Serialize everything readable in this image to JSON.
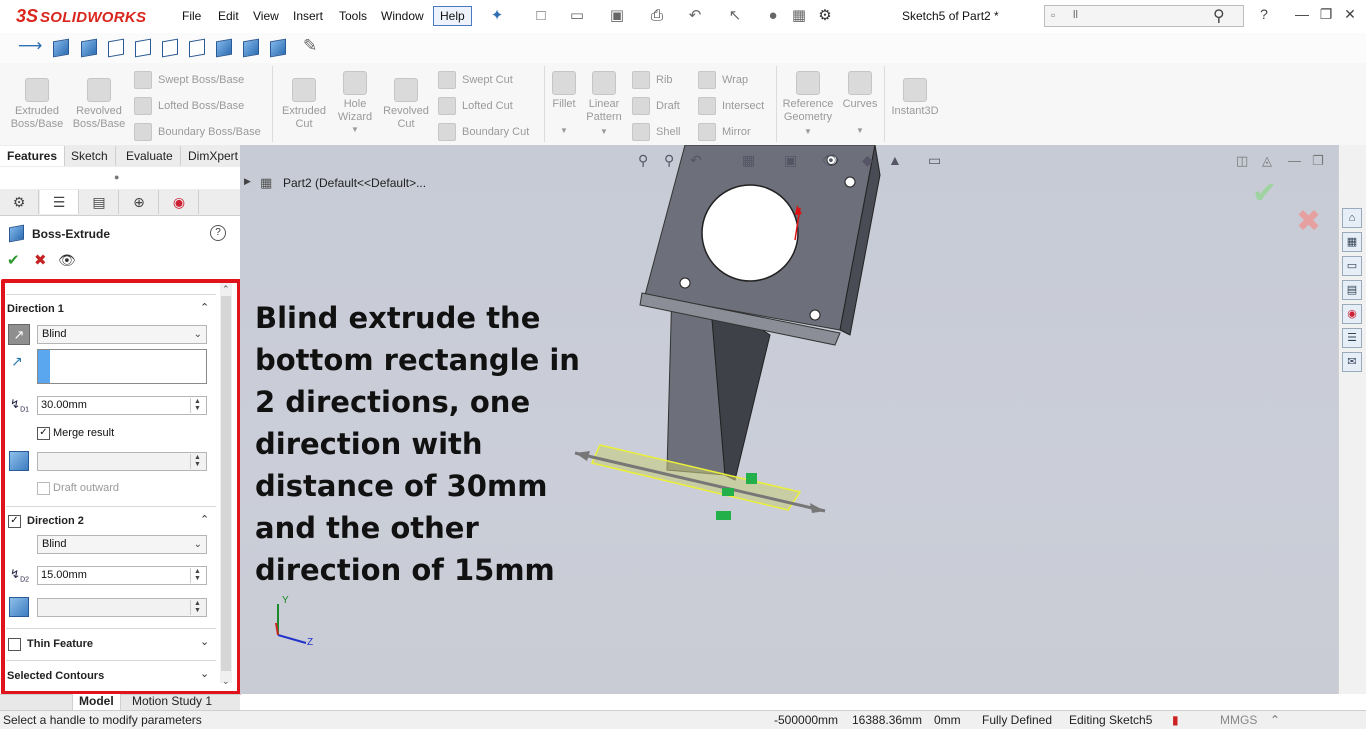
{
  "app": {
    "brand": "SOLIDWORKS",
    "document_title": "Sketch5 of Part2 *",
    "menu": [
      "File",
      "Edit",
      "View",
      "Insert",
      "Tools",
      "Window",
      "Help"
    ],
    "search_value": "ll"
  },
  "command_manager": {
    "groups": [
      {
        "label": "Extruded\nBoss/Base"
      },
      {
        "label": "Revolved\nBoss/Base"
      }
    ],
    "boss_rows": [
      "Swept Boss/Base",
      "Lofted Boss/Base",
      "Boundary Boss/Base"
    ],
    "cut_big": [
      {
        "label": "Extruded\nCut"
      },
      {
        "label": "Hole\nWizard"
      },
      {
        "label": "Revolved\nCut"
      }
    ],
    "cut_rows": [
      "Swept Cut",
      "Lofted Cut",
      "Boundary Cut"
    ],
    "feature_big": [
      {
        "label": "Fillet"
      },
      {
        "label": "Linear\nPattern"
      }
    ],
    "feature_rows_a": [
      "Rib",
      "Draft",
      "Shell"
    ],
    "feature_rows_b": [
      "Wrap",
      "Intersect",
      "Mirror"
    ],
    "ref_big": [
      {
        "label": "Reference\nGeometry"
      },
      {
        "label": "Curves"
      },
      {
        "label": "Instant3D"
      }
    ]
  },
  "tabs": [
    "Features",
    "Sketch",
    "Evaluate",
    "DimXpert"
  ],
  "property_manager": {
    "title": "Boss-Extrude",
    "help": "?",
    "direction1": {
      "title": "Direction 1",
      "end_condition": "Blind",
      "depth": "30.00mm",
      "merge_result_label": "Merge result",
      "merge_result_checked": true,
      "draft_outward_label": "Draft outward",
      "draft_outward_checked": false
    },
    "direction2": {
      "title": "Direction 2",
      "checked": true,
      "end_condition": "Blind",
      "depth": "15.00mm"
    },
    "thin_feature": {
      "title": "Thin Feature",
      "checked": false
    },
    "selected_contours": {
      "title": "Selected Contours"
    }
  },
  "bottom_tabs": [
    "Model",
    "Motion Study 1"
  ],
  "tree": {
    "node": "Part2  (Default<<Default>..."
  },
  "annotation": "Blind extrude the bottom rectangle in 2 directions, one direction with distance of 30mm and the other direction of 15mm",
  "triad": {
    "y": "Y",
    "z": "Z"
  },
  "status": {
    "message": "Select a handle to modify parameters",
    "x": "-500000mm",
    "y": "16388.36mm",
    "z": "0mm",
    "state": "Fully Defined",
    "mode": "Editing Sketch5",
    "units": "MMGS"
  },
  "colors": {
    "brand_red": "#d9261c",
    "highlight_frame": "#e0121b",
    "model_gray": "#6d6f7a",
    "selection_yellow": "#e9ef3a",
    "viewport_bg": "#c9ccd5"
  }
}
